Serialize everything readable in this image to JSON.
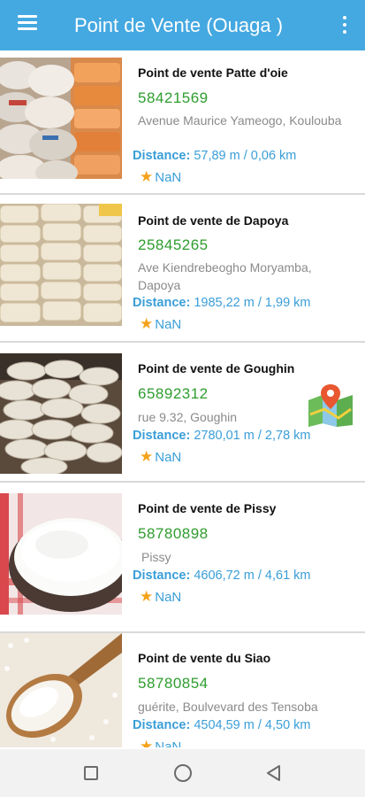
{
  "appbar": {
    "title": "Point de Vente (Ouaga )",
    "menu_icon": "hamburger-menu-icon",
    "more_icon": "more-vertical-icon"
  },
  "distance_label": "Distance:",
  "items": [
    {
      "name": "Point de vente Patte d'oie",
      "phone": "58421569",
      "address": "Avenue Maurice Yameogo, Koulouba",
      "distance": "57,89 m / 0,06 km",
      "rating": "NaN",
      "image": "rice-bags-stacked-photo"
    },
    {
      "name": "Point de vente de Dapoya",
      "phone": "25845265",
      "address": "Ave Kiendrebeogho Moryamba, Dapoya",
      "distance": "1985,22 m / 1,99 km",
      "rating": "NaN",
      "image": "white-sacks-stacked-photo"
    },
    {
      "name": "Point de vente de Goughin",
      "phone": "65892312",
      "address": "rue 9.32, Goughin",
      "distance": "2780,01 m / 2,78 km",
      "rating": "NaN",
      "image": "sacks-pile-warehouse-photo"
    },
    {
      "name": "Point de vente de Pissy",
      "phone": "58780898",
      "address": "Pissy",
      "distance": "4606,72 m / 4,61 km",
      "rating": "NaN",
      "image": "rice-bowl-photo"
    },
    {
      "name": "Point de vente du Siao",
      "phone": "58780854",
      "address": "guérite, Boulvevard des Tensoba",
      "distance": "4504,59 m / 4,50 km",
      "rating": "NaN",
      "image": "rice-wooden-spoon-photo"
    }
  ],
  "colors": {
    "appbar": "#44a8e1",
    "phone": "#2e9d2e",
    "distance": "#3a9ed8",
    "star": "#f4a21b",
    "address": "#8a8a8a"
  }
}
